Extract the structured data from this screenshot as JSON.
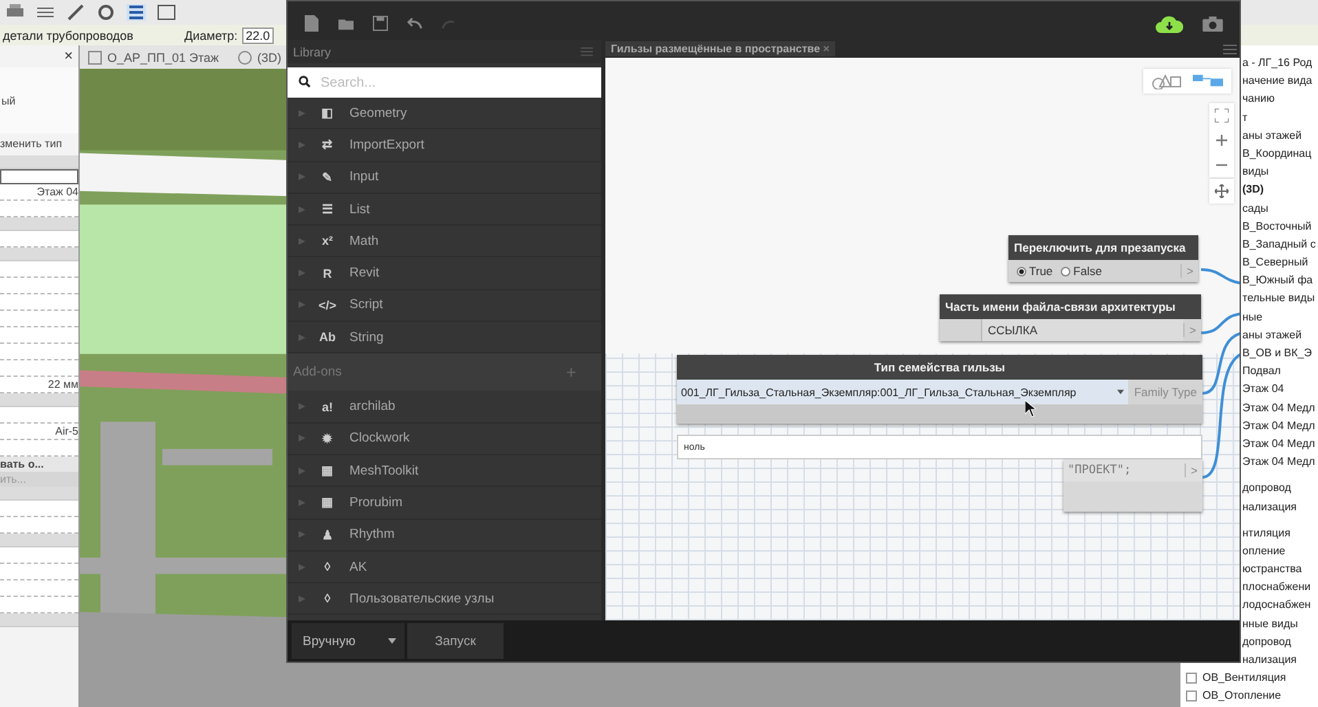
{
  "revit": {
    "options_bar": {
      "label": "детали трубопроводов",
      "diameter_label": "Диаметр:",
      "diameter_value": "22.0"
    },
    "properties": {
      "close": "×",
      "rows": [
        {
          "kind": "type",
          "text": "ый"
        },
        {
          "kind": "link",
          "text": "зменить тип"
        },
        {
          "kind": "header"
        },
        {
          "kind": "input"
        },
        {
          "kind": "value",
          "text": "Этаж 04"
        },
        {
          "kind": "blank"
        },
        {
          "kind": "header"
        },
        {
          "kind": "blank"
        },
        {
          "kind": "header"
        },
        {
          "kind": "blank"
        },
        {
          "kind": "blank"
        },
        {
          "kind": "blank"
        },
        {
          "kind": "blank"
        },
        {
          "kind": "blank"
        },
        {
          "kind": "blank"
        },
        {
          "kind": "blank"
        },
        {
          "kind": "value",
          "text": "22 мм"
        },
        {
          "kind": "header"
        },
        {
          "kind": "blank"
        },
        {
          "kind": "value",
          "text": "Air-5"
        },
        {
          "kind": "blank"
        },
        {
          "kind": "button",
          "text": "вать о..."
        },
        {
          "kind": "greyed",
          "text": "ить..."
        },
        {
          "kind": "header"
        },
        {
          "kind": "blank"
        },
        {
          "kind": "blank"
        },
        {
          "kind": "header"
        },
        {
          "kind": "blank"
        },
        {
          "kind": "blank"
        },
        {
          "kind": "blank"
        },
        {
          "kind": "blank"
        },
        {
          "kind": "header"
        }
      ]
    },
    "view_tabs": [
      {
        "label": "О_АР_ПП_01 Этаж",
        "kind": "plan"
      },
      {
        "label": "(3D)",
        "kind": "model"
      }
    ],
    "browser": [
      {
        "kind": "row",
        "text": "а - ЛГ_16 Род"
      },
      {
        "kind": "row",
        "text": "начение вида"
      },
      {
        "kind": "row",
        "text": "чанию"
      },
      {
        "kind": "row",
        "text": "т"
      },
      {
        "kind": "row",
        "text": "аны этажей"
      },
      {
        "kind": "row",
        "text": "В_Координац"
      },
      {
        "kind": "row",
        "text": "виды"
      },
      {
        "kind": "bold",
        "text": "(3D)"
      },
      {
        "kind": "row",
        "text": "сады"
      },
      {
        "kind": "row",
        "text": "В_Восточный"
      },
      {
        "kind": "row",
        "text": "В_Западный с"
      },
      {
        "kind": "row",
        "text": "В_Северный"
      },
      {
        "kind": "row",
        "text": "В_Южный фа"
      },
      {
        "kind": "row",
        "text": "тельные виды"
      },
      {
        "kind": "row",
        "text": "ные"
      },
      {
        "kind": "row",
        "text": "аны этажей"
      },
      {
        "kind": "row",
        "text": "В_ОВ и ВК_Э"
      },
      {
        "kind": "row",
        "text": "Подвал"
      },
      {
        "kind": "row",
        "text": "Этаж 04"
      },
      {
        "kind": "row",
        "text": "Этаж 04 Медл"
      },
      {
        "kind": "row",
        "text": "Этаж 04 Медл"
      },
      {
        "kind": "row",
        "text": "Этаж 04 Медл"
      },
      {
        "kind": "row",
        "text": "Этаж 04 Медл"
      },
      {
        "kind": "gap"
      },
      {
        "kind": "row",
        "text": "допровод"
      },
      {
        "kind": "row",
        "text": "нализация"
      },
      {
        "kind": "gap"
      },
      {
        "kind": "row",
        "text": "нтиляция"
      },
      {
        "kind": "row",
        "text": "опление"
      },
      {
        "kind": "row",
        "text": "юстранства"
      },
      {
        "kind": "row",
        "text": "плоснабжени"
      },
      {
        "kind": "row",
        "text": "лодоснабжен"
      },
      {
        "kind": "row",
        "text": "нные виды"
      },
      {
        "kind": "row",
        "text": "допровод"
      },
      {
        "kind": "row",
        "text": "нализация"
      },
      {
        "kind": "folder",
        "text": "ОВ_Вентиляция"
      },
      {
        "kind": "folder",
        "text": "ОВ_Отопление"
      }
    ]
  },
  "dynamo": {
    "library": {
      "title": "Library",
      "search": {
        "placeholder": "Search..."
      },
      "items": [
        {
          "icon": "◧",
          "label": "Geometry"
        },
        {
          "icon": "⇄",
          "label": "ImportExport"
        },
        {
          "icon": "✎",
          "label": "Input"
        },
        {
          "icon": "☰",
          "label": "List"
        },
        {
          "icon": "x²",
          "label": "Math"
        },
        {
          "icon": "R",
          "label": "Revit"
        },
        {
          "icon": "</>",
          "label": "Script"
        },
        {
          "icon": "Ab",
          "label": "String"
        }
      ],
      "addons_title": "Add-ons",
      "addons_add": "+",
      "addons": [
        {
          "icon": "a!",
          "label": "archilab"
        },
        {
          "icon": "✹",
          "label": "Clockwork"
        },
        {
          "icon": "▦",
          "label": "MeshToolkit"
        },
        {
          "icon": "▦",
          "label": "Prorubim"
        },
        {
          "icon": "♟",
          "label": "Rhythm"
        },
        {
          "icon": "◊",
          "label": "AK"
        },
        {
          "icon": "◊",
          "label": "Пользовательские узлы"
        }
      ]
    },
    "tab": {
      "label": "Гильзы размещённые в пространстве",
      "close": "×"
    },
    "nodes": [
      {
        "kind": "toggle",
        "title": "Переключить для презапуска",
        "options": [
          {
            "label": "True",
            "selected": true
          },
          {
            "label": "False",
            "selected": false
          }
        ],
        "port": ">"
      },
      {
        "kind": "string",
        "title": "Часть имени файла-связи архитектуры",
        "value": "ССЫЛКА",
        "port": ">"
      },
      {
        "kind": "dropdown",
        "title": "Тип семейства гильзы",
        "value": "001_ЛГ_Гильза_Стальная_Экземпляр:001_ЛГ_Гильза_Стальная_Экземпляр",
        "output": "Family Type"
      },
      {
        "kind": "note",
        "value": "ноль"
      },
      {
        "kind": "code",
        "value": "\"ПРОЕКТ\";",
        "port": ">"
      }
    ],
    "run_mode": "Вручную",
    "run_button": "Запуск"
  }
}
